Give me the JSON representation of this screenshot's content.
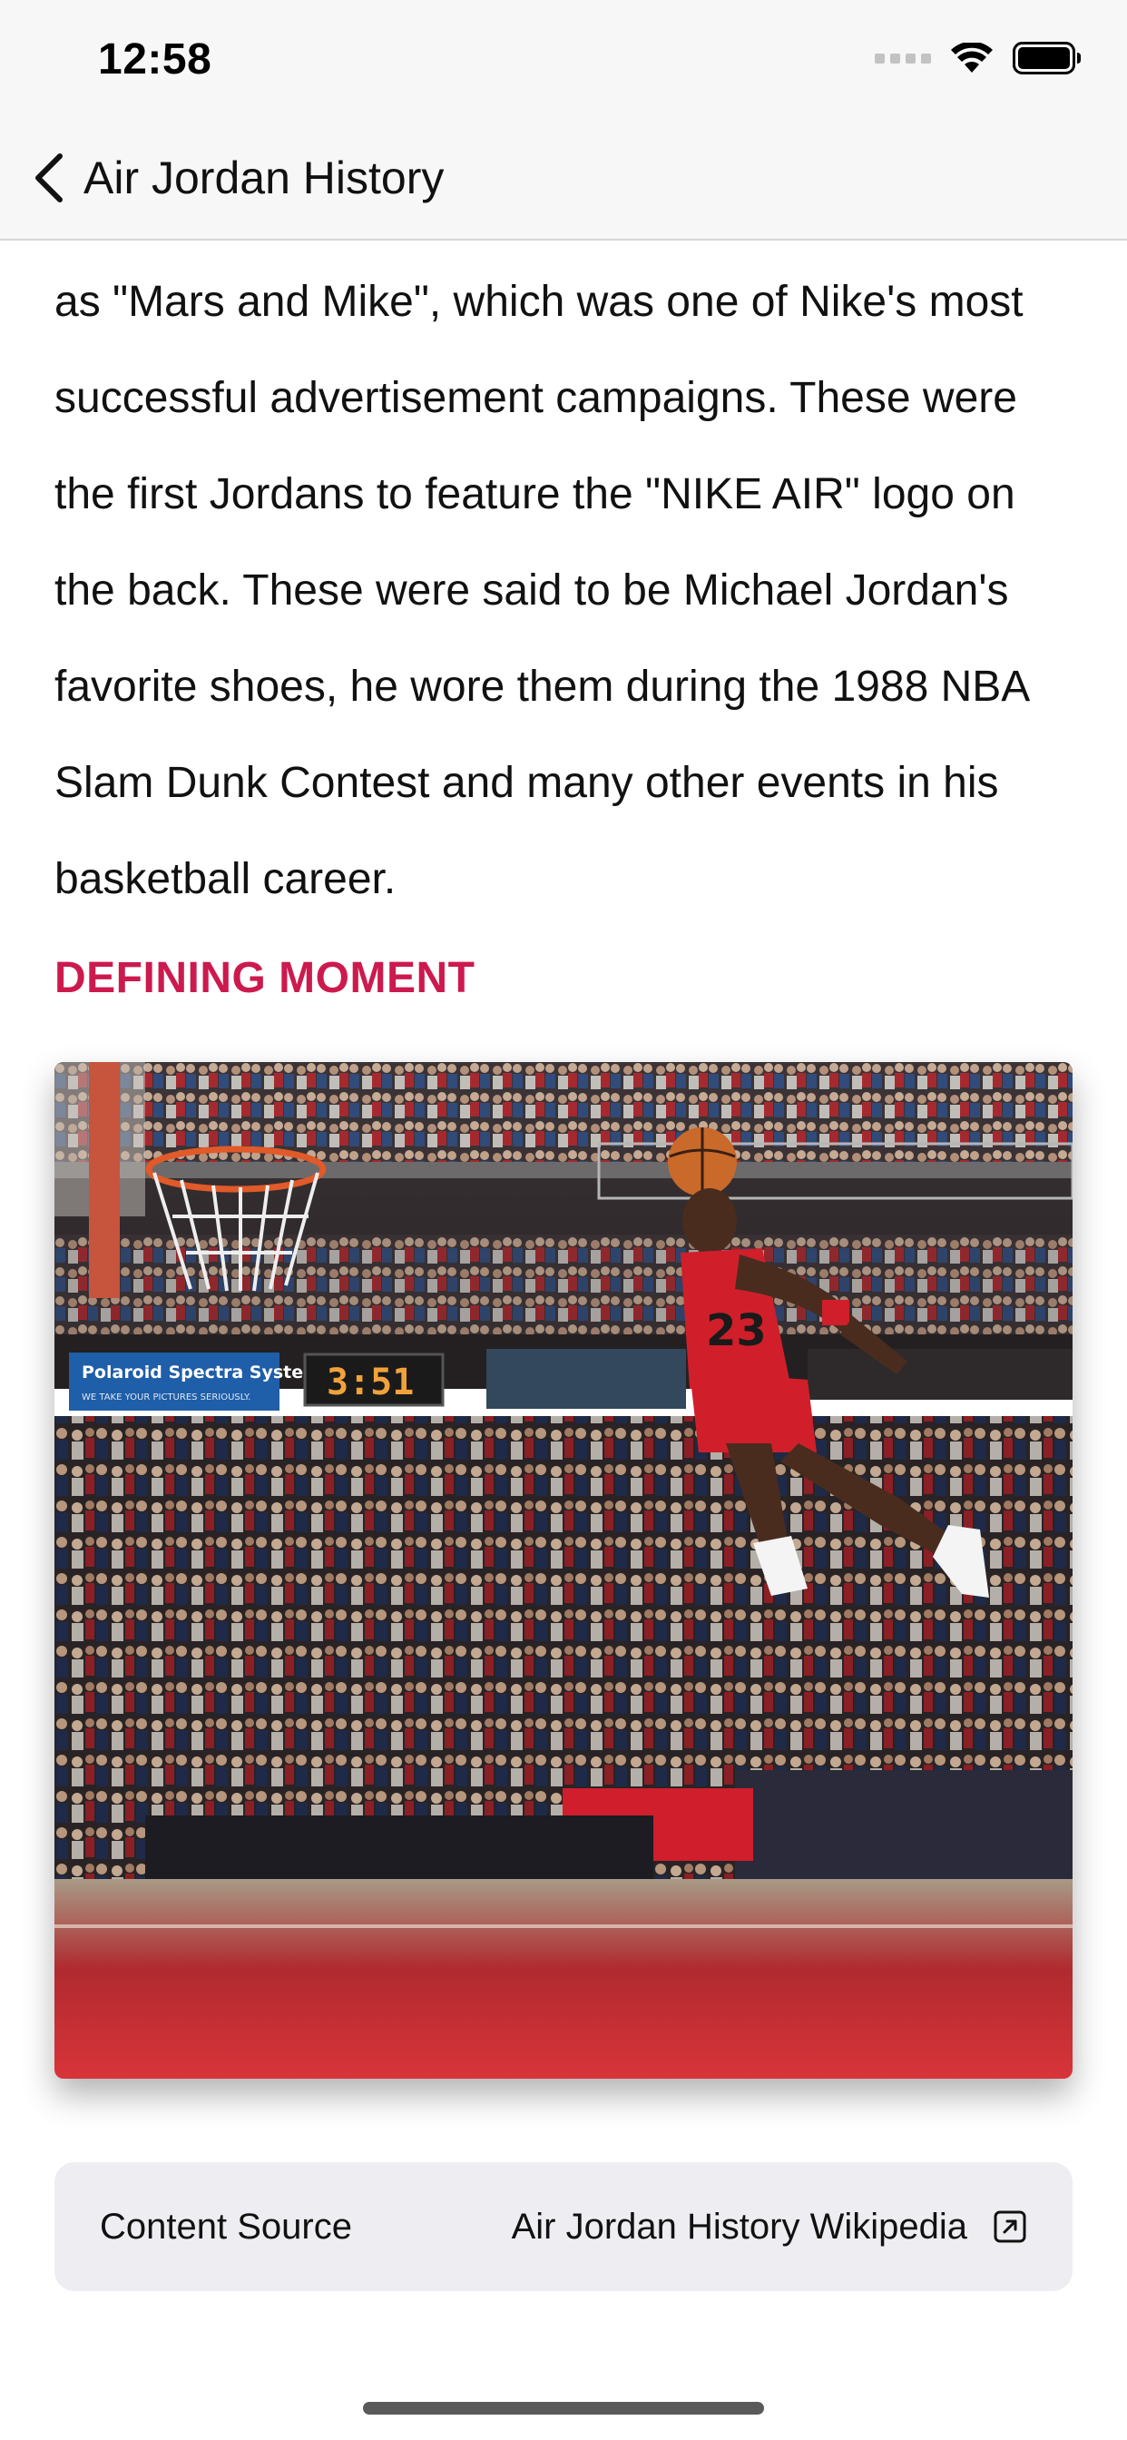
{
  "status_bar": {
    "time": "12:58",
    "icons": [
      "cellular-signal-icon",
      "wifi-icon",
      "battery-icon"
    ]
  },
  "nav": {
    "back_icon": "chevron-left-icon",
    "title": "Air Jordan History"
  },
  "article": {
    "paragraph": "as \"Mars and Mike\", which was one of Nike's most successful advertisement campaigns. These were the first Jordans to feature the \"NIKE AIR\" logo on the back. These were said to be Michael Jordan's favorite shoes, he wore them during the 1988 NBA Slam Dunk Contest and many other events in his basketball career."
  },
  "section": {
    "heading": "DEFINING MOMENT",
    "heading_color": "#cc1a4e"
  },
  "photo": {
    "scoreboard": "3:51",
    "banner_line1": "Polaroid Spectra System.",
    "banner_line2": "WE TAKE YOUR PICTURES SERIOUSLY.",
    "jersey_number": "23"
  },
  "source": {
    "label": "Content Source",
    "link_text": "Air Jordan History Wikipedia",
    "link_icon": "external-link-icon"
  }
}
